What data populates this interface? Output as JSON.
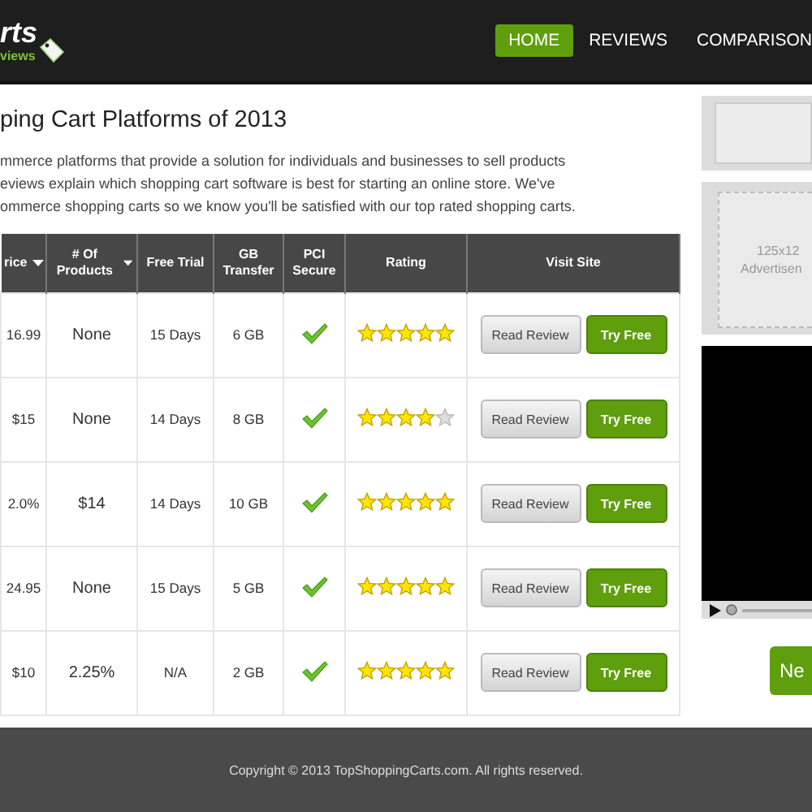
{
  "logo": {
    "title": "rts",
    "subtitle": "views"
  },
  "nav": [
    {
      "label": "HOME",
      "selected": true
    },
    {
      "label": "REVIEWS",
      "selected": false
    },
    {
      "label": "COMPARISON",
      "selected": false
    }
  ],
  "heading": "ping Cart Platforms of 2013",
  "intro": [
    "mmerce platforms that provide a solution for individuals and businesses to sell products",
    "eviews explain which shopping cart software is best for starting an online store. We've",
    "ommerce shopping carts so we know you'll be satisfied with our top rated shopping carts."
  ],
  "table": {
    "columns": [
      {
        "label": "rice",
        "sortable": true
      },
      {
        "label": "# Of Products",
        "sortable": true
      },
      {
        "label": "Free Trial",
        "sortable": false
      },
      {
        "label": "GB Transfer",
        "sortable": false
      },
      {
        "label": "PCI Secure",
        "sortable": false
      },
      {
        "label": "Rating",
        "sortable": false
      },
      {
        "label": "Visit Site",
        "sortable": false
      }
    ],
    "rows": [
      {
        "price": "16.99",
        "products": "None",
        "trial": "15 Days",
        "transfer": "6 GB",
        "pci": true,
        "stars": 5,
        "review": "Read Review",
        "try": "Try Free"
      },
      {
        "price": "$15",
        "products": "None",
        "trial": "14 Days",
        "transfer": "8 GB",
        "pci": true,
        "stars": 4,
        "review": "Read Review",
        "try": "Try Free"
      },
      {
        "price": "2.0%",
        "products": "$14",
        "trial": "14 Days",
        "transfer": "10 GB",
        "pci": true,
        "stars": 5,
        "review": "Read Review",
        "try": "Try Free"
      },
      {
        "price": "24.95",
        "products": "None",
        "trial": "15 Days",
        "transfer": "5 GB",
        "pci": true,
        "stars": 5,
        "review": "Read Review",
        "try": "Try Free"
      },
      {
        "price": "$10",
        "products": "2.25%",
        "trial": "N/A",
        "transfer": "2 GB",
        "pci": true,
        "stars": 5,
        "review": "Read Review",
        "try": "Try Free"
      }
    ]
  },
  "sidebar": {
    "ad": [
      "125x12",
      "Advertisen"
    ],
    "button": "Ne"
  },
  "footer": "Copyright © 2013 TopShoppingCarts.com. All rights reserved."
}
